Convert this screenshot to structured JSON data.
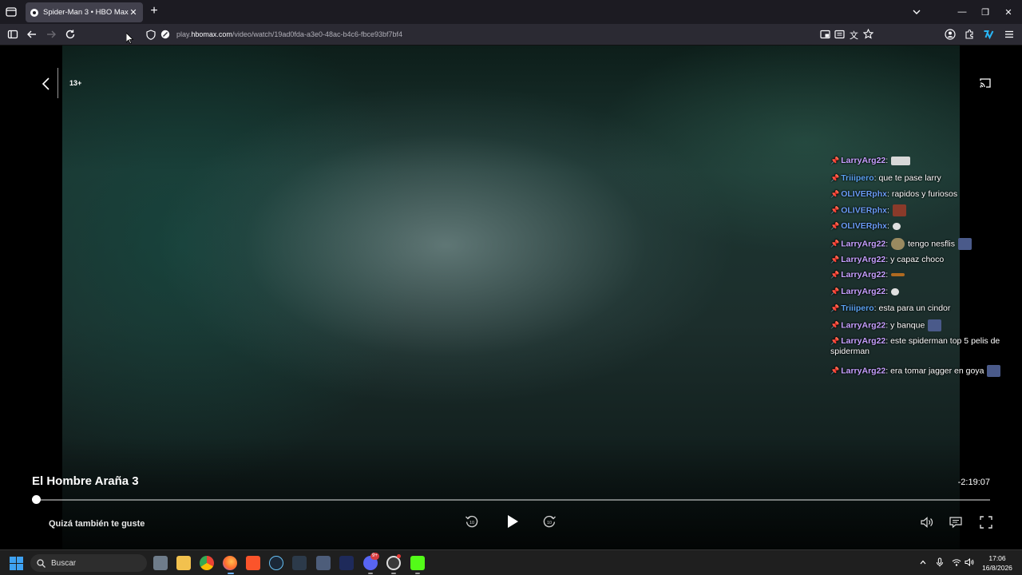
{
  "browser": {
    "tab_title": "Spider-Man 3 • HBO Max",
    "tab_close": "✕",
    "new_tab": "+",
    "url_prefix": "play.",
    "url_domain": "hbomax.com",
    "url_path": "/video/watch/19ad0fda-a3e0-48ac-b4c6-fbce93bf7bf4",
    "window_minimize": "—",
    "window_restore": "❐",
    "window_close": "✕"
  },
  "player": {
    "rating": "13+",
    "movie_title": "El Hombre Araña 3",
    "time_remaining": "-2:19:07",
    "progress_fraction": 0.0,
    "suggestions_label": "Quizá también te guste"
  },
  "chat": {
    "messages": [
      {
        "user": "LarryArg22",
        "text": "",
        "emotes": [
          "#d8d8d8"
        ]
      },
      {
        "user": "Triiipero",
        "text": "que te pase larry",
        "emotes": []
      },
      {
        "user": "OLIVERphx",
        "text": "rapidos y furiosos",
        "emotes": []
      },
      {
        "user": "OLIVERphx",
        "text": "",
        "emotes": [
          "#8a3a2a"
        ]
      },
      {
        "user": "OLIVERphx",
        "text": "",
        "emotes": [
          "#e0e0e0"
        ]
      },
      {
        "user": "LarryArg22",
        "text": "tengo nesflis",
        "emotes": [
          "#9a8a60",
          "#4a5a8a"
        ]
      },
      {
        "user": "LarryArg22",
        "text": "y capaz choco",
        "emotes": []
      },
      {
        "user": "LarryArg22",
        "text": "",
        "emotes": [
          "#b06a20"
        ]
      },
      {
        "user": "LarryArg22",
        "text": "",
        "emotes": [
          "#e0e0e0"
        ]
      },
      {
        "user": "Triiipero",
        "text": "esta para un cindor",
        "emotes": []
      },
      {
        "user": "LarryArg22",
        "text": "y banque",
        "emotes": [
          "#4a5a8a"
        ]
      },
      {
        "user": "LarryArg22",
        "text": "este spiderman top 5 pelis de spiderman",
        "emotes": []
      },
      {
        "user": "LarryArg22",
        "text": "era tomar jagger en goya",
        "emotes": [
          "#4a5a8a"
        ]
      }
    ]
  },
  "taskbar": {
    "search_placeholder": "Buscar",
    "time": "17:06",
    "date": "16/8/2026",
    "discord_badge": "9+"
  },
  "colors": {
    "tabbar_bg": "#1c1b22",
    "navbar_bg": "#2b2a33",
    "chat_user_larry": "#c6a0ff",
    "chat_user_triiipero": "#5aa2f0",
    "chat_user_oliver": "#6a9cf5"
  }
}
